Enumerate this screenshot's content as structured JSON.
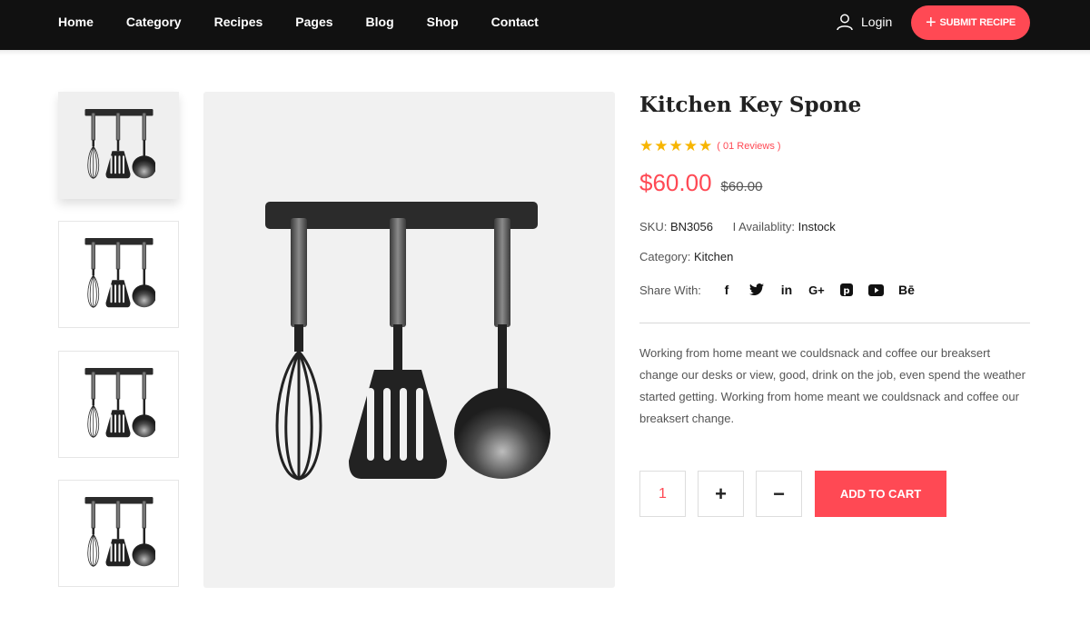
{
  "nav": {
    "items": [
      "Home",
      "Category",
      "Recipes",
      "Pages",
      "Blog",
      "Shop",
      "Contact"
    ],
    "login_label": "Login",
    "submit_label": "SUBMIT RECIPE"
  },
  "product": {
    "title": "Kitchen Key Spone",
    "rating_stars": 5,
    "reviews": "( 01 Reviews )",
    "price": "$60.00",
    "old_price": "$60.00",
    "sku_label": "SKU:",
    "sku": "BN3056",
    "availability_label": "I Availablity:",
    "availability": "Instock",
    "category_label": "Category:",
    "category": "Kitchen",
    "share_label": "Share With:",
    "share_icons": [
      "facebook-icon",
      "twitter-icon",
      "linkedin-icon",
      "google-plus-icon",
      "pinterest-icon",
      "youtube-icon",
      "behance-icon"
    ],
    "description": "Working from home meant we couldsnack and coffee our breaksert change our desks or view, good, drink on the job, even spend the weather started getting. Working from home meant we couldsnack and coffee our breaksert change.",
    "quantity": "1",
    "plus_label": "+",
    "minus_label": "−",
    "cart_label": "ADD TO CART"
  },
  "colors": {
    "accent": "#ff4954",
    "header": "#111111",
    "star": "#f7b500"
  }
}
